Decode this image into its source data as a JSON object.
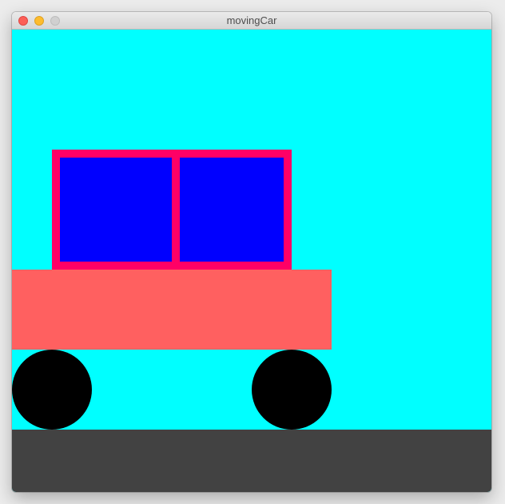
{
  "window": {
    "title": "movingCar"
  },
  "controls": {
    "close_icon": "close-icon",
    "minimize_icon": "minimize-icon",
    "maximize_icon": "maximize-icon"
  },
  "scene": {
    "sky_color": "#00ffff",
    "ground_color": "#424242",
    "car": {
      "cabin_color": "#ff0066",
      "window_color": "#0000ff",
      "body_color": "#ff6060",
      "wheel_color": "#000000"
    }
  }
}
